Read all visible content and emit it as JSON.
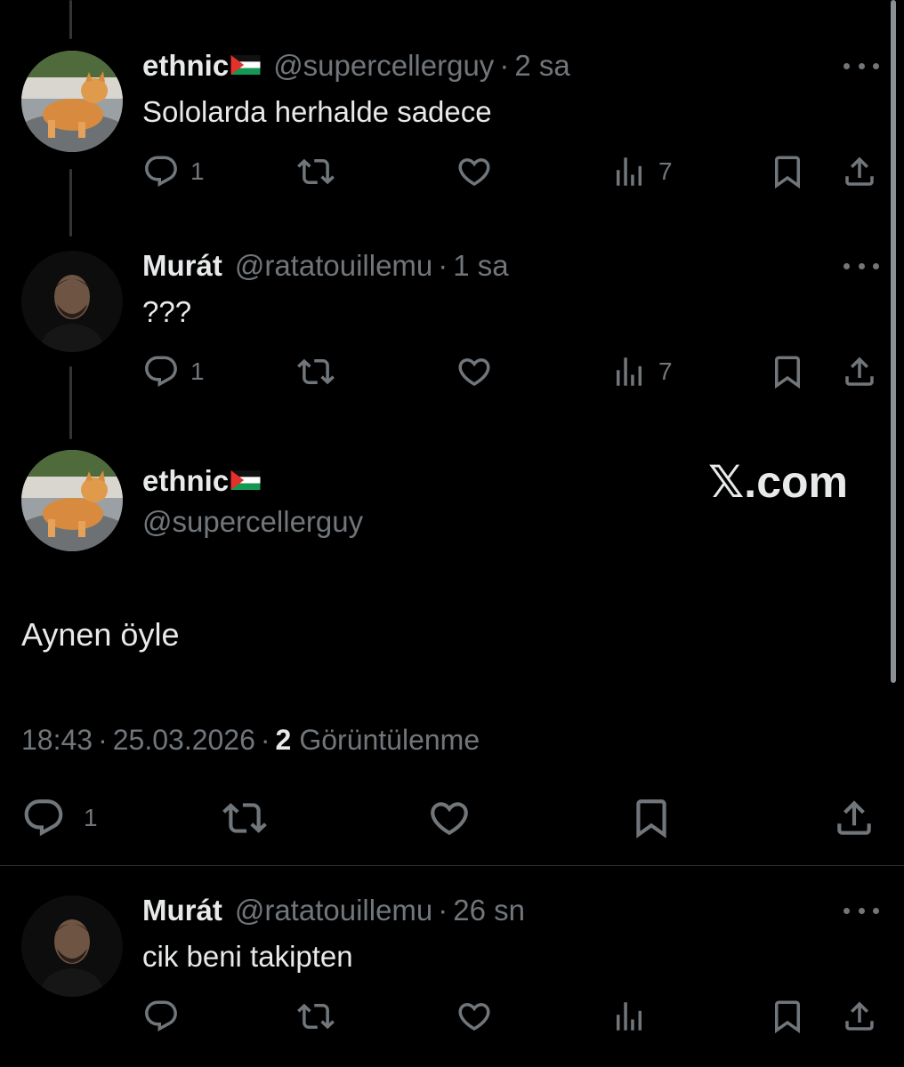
{
  "colors": {
    "background": "#000000",
    "text_primary": "#e7e9ea",
    "text_secondary": "#71767b",
    "thread_line": "#333639",
    "divider": "#2f3336"
  },
  "tweets": [
    {
      "name": "ethnic",
      "flag_icon": "palestine-flag-icon",
      "handle": "@supercellerguy",
      "time": "2 sa",
      "text": "Sololarda herhalde sadece",
      "replies": "1",
      "views": "7"
    },
    {
      "name": "Murát",
      "handle": "@ratatouillemu",
      "time": "1 sa",
      "text": "???",
      "replies": "1",
      "views": "7"
    }
  ],
  "main_tweet": {
    "name": "ethnic",
    "flag_icon": "palestine-flag-icon",
    "handle": "@supercellerguy",
    "text": "Aynen öyle",
    "time": "18:43",
    "date": "25.03.2026",
    "views_count": "2",
    "views_label": "Görüntülenme",
    "replies": "1"
  },
  "watermark": {
    "x_glyph": "𝕏",
    "suffix": ".com"
  },
  "reply": {
    "name": "Murát",
    "handle": "@ratatouillemu",
    "time": "26 sn",
    "text": "cik beni takipten"
  },
  "separator": "·"
}
